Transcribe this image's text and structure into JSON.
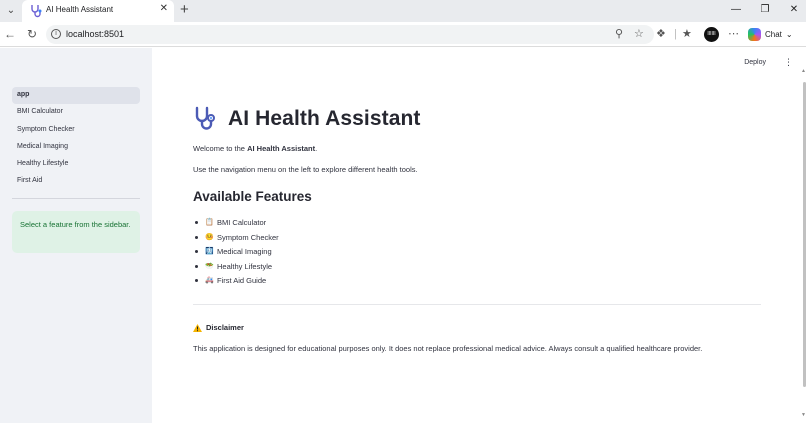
{
  "browser": {
    "tab_title": "AI Health Assistant",
    "url": "localhost:8501",
    "chat_label": "Chat",
    "avatar_label": "IIIIII",
    "accent_color": "#0b57d0"
  },
  "app": {
    "deploy_label": "Deploy",
    "sidebar": {
      "items": [
        {
          "label": "app"
        },
        {
          "label": "BMI Calculator"
        },
        {
          "label": "Symptom Checker"
        },
        {
          "label": "Medical Imaging"
        },
        {
          "label": "Healthy Lifestyle"
        },
        {
          "label": "First Aid"
        }
      ],
      "info": "Select a feature from the sidebar.",
      "info_color": "#177233",
      "info_bg": "#dff2e6"
    },
    "main": {
      "title": "AI Health Assistant",
      "welcome_prefix": "Welcome to the ",
      "welcome_bold": "AI Health Assistant",
      "welcome_suffix": ".",
      "intro": "Use the navigation menu on the left to explore different health tools.",
      "features_heading": "Available Features",
      "features": [
        {
          "icon": "📋",
          "label": "BMI Calculator",
          "icon_name": "clipboard-icon"
        },
        {
          "icon": "🤒",
          "label": "Symptom Checker",
          "icon_name": "face-thermometer-icon"
        },
        {
          "icon": "🩻",
          "label": "Medical Imaging",
          "icon_name": "xray-icon"
        },
        {
          "icon": "🥗",
          "label": "Healthy Lifestyle",
          "icon_name": "salad-icon"
        },
        {
          "icon": "🚑",
          "label": "First Aid Guide",
          "icon_name": "ambulance-icon"
        }
      ],
      "disclaimer_heading": "Disclaimer",
      "disclaimer_text": "This application is designed for educational purposes only. It does not replace professional medical advice. Always consult a qualified healthcare provider."
    }
  }
}
